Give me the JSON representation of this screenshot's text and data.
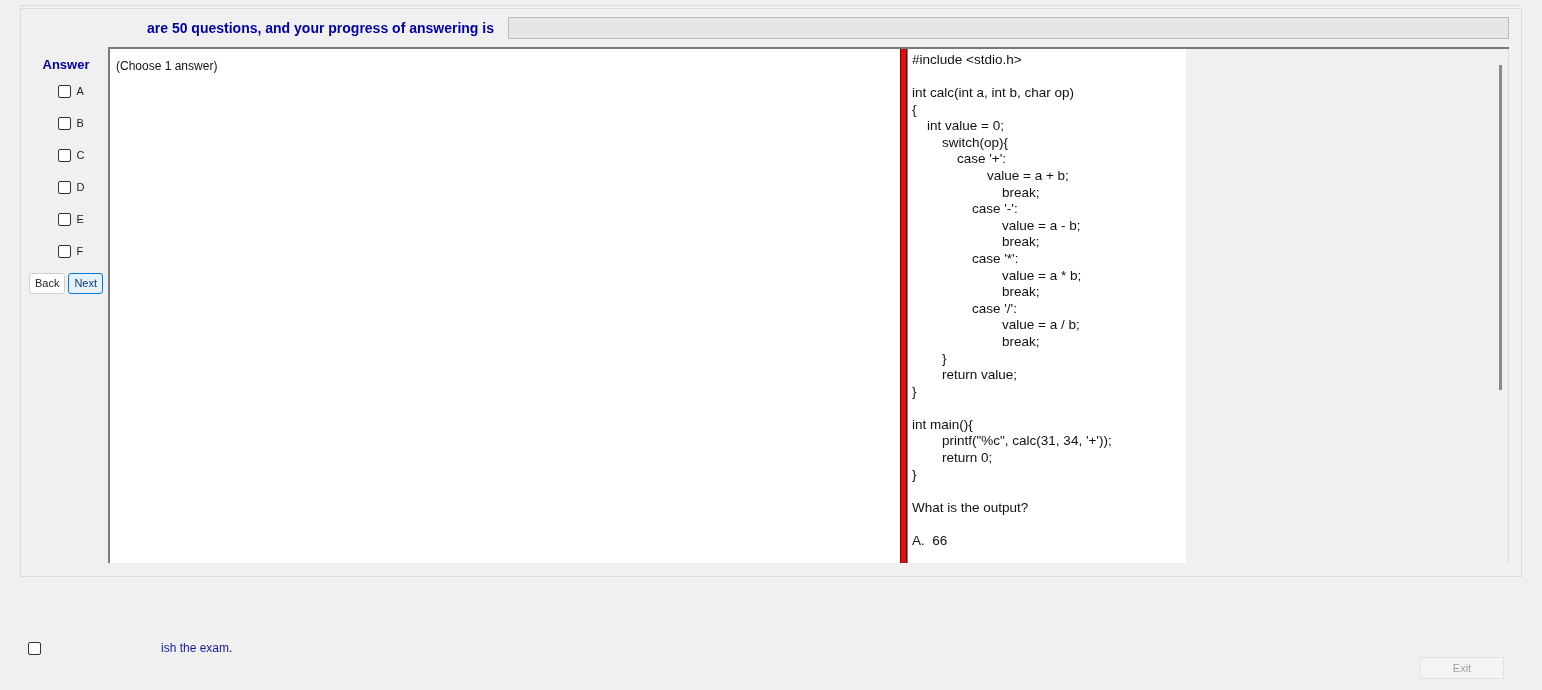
{
  "header": {
    "text": "are 50 questions, and your progress of answering is",
    "progress": {
      "level": 0
    }
  },
  "answer_panel": {
    "title": "Answer",
    "options": [
      {
        "label": "A",
        "checked": false
      },
      {
        "label": "B",
        "checked": false
      },
      {
        "label": "C",
        "checked": false
      },
      {
        "label": "D",
        "checked": false
      },
      {
        "label": "E",
        "checked": false
      },
      {
        "label": "F",
        "checked": false
      }
    ],
    "buttons": [
      {
        "label": "Back",
        "kind": "plain"
      },
      {
        "label": "Next",
        "kind": "focused"
      }
    ]
  },
  "question": {
    "instruction": "(Choose 1 answer)",
    "blocks": [
      [
        "#include <stdio.h>"
      ],
      [
        "int calc(int a, int b, char op)",
        "{",
        "    int value = 0;",
        "        switch(op){",
        "            case '+':",
        "                    value = a + b;",
        "                        break;",
        "                case '-':",
        "                        value = a - b;",
        "                        break;",
        "                case '*':",
        "                        value = a * b;",
        "                        break;",
        "                case '/':",
        "                        value = a / b;",
        "                        break;",
        "        }",
        "        return value;",
        "}"
      ],
      [
        "int main(){",
        "        printf(\"%c\", calc(31, 34, '+'));",
        "        return 0;",
        "}"
      ],
      [
        "What is the output?"
      ],
      [
        "A.  66"
      ]
    ]
  },
  "footer": {
    "confirm": {
      "label": "ish the exam.",
      "checked": false
    },
    "exit_button": {
      "label": "Exit",
      "disabled": true
    }
  }
}
